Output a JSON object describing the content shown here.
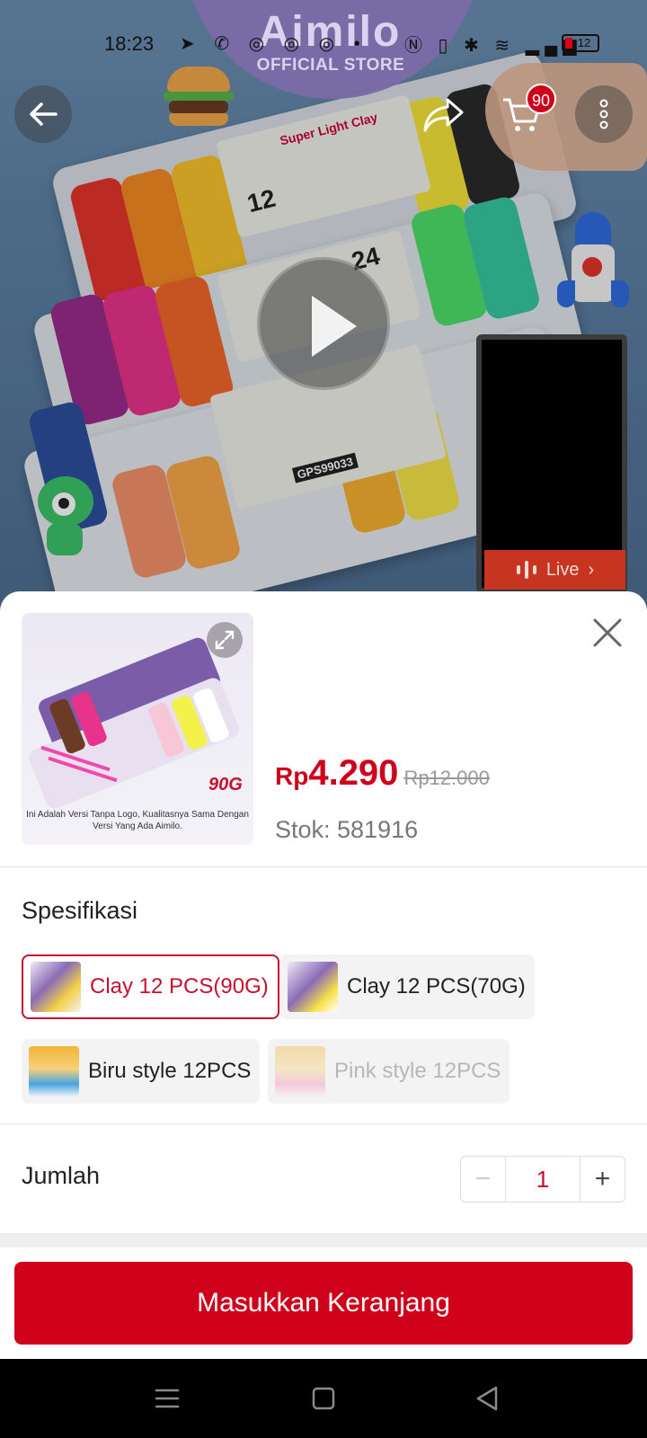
{
  "status_bar": {
    "time": "18:23",
    "battery": "12"
  },
  "brand": {
    "name": "Aimilo",
    "subtitle": "OFFICIAL STORE"
  },
  "header": {
    "cart_count": "90"
  },
  "hero": {
    "pack_labels": [
      "Super Light Clay",
      "12",
      "24",
      "GPS99033"
    ],
    "live_label": "Live"
  },
  "product": {
    "thumbnail_caption": "Ini Adalah Versi Tanpa Logo, Kualitasnya Sama Dengan Versi Yang Ada Aimilo.",
    "thumbnail_weight": "90G",
    "price_currency": "Rp",
    "price": "4.290",
    "original_price": "Rp12.000",
    "stock": "Stok: 581916"
  },
  "spec": {
    "title": "Spesifikasi",
    "options": [
      {
        "label": "Clay 12 PCS(90G)",
        "state": "selected"
      },
      {
        "label": "Clay 12 PCS(70G)",
        "state": "normal"
      },
      {
        "label": "Biru style 12PCS",
        "state": "normal"
      },
      {
        "label": "Pink style 12PCS",
        "state": "disabled"
      }
    ]
  },
  "quantity": {
    "label": "Jumlah",
    "value": "1",
    "minus_symbol": "−",
    "plus_symbol": "+"
  },
  "cta": {
    "label": "Masukkan Keranjang"
  },
  "colors": {
    "accent": "#d0011b",
    "selected_border": "#c8102e"
  },
  "icons": [
    "back-arrow-icon",
    "share-icon",
    "cart-icon",
    "more-vertical-icon",
    "play-icon",
    "live-audio-icon",
    "expand-icon",
    "close-icon",
    "menu-icon",
    "home-icon",
    "back-triangle-icon"
  ]
}
